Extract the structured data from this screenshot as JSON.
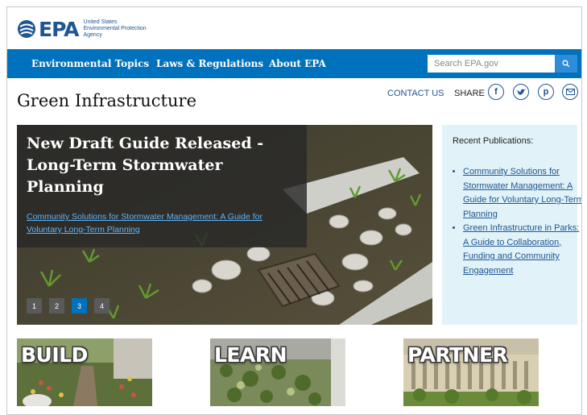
{
  "header": {
    "logo_text": "EPA",
    "agency_lines": [
      "United States",
      "Environmental Protection",
      "Agency"
    ]
  },
  "nav": {
    "items": [
      {
        "label": "Environmental Topics"
      },
      {
        "label": "Laws & Regulations"
      },
      {
        "label": "About EPA"
      }
    ],
    "search_placeholder": "Search EPA.gov"
  },
  "page": {
    "title": "Green Infrastructure",
    "contact_label": "CONTACT US",
    "share_label": "SHARE",
    "share_icons": [
      "facebook-icon",
      "twitter-icon",
      "pinterest-icon",
      "email-icon"
    ]
  },
  "carousel": {
    "title": "New Draft Guide Released - Long-Term Stormwater Planning",
    "link_text": "Community Solutions for Stormwater Management: A Guide for Voluntary Long-Term Planning",
    "pages": [
      "1",
      "2",
      "3",
      "4"
    ],
    "active_page": "3"
  },
  "sidebar": {
    "title": "Recent Publications:",
    "items": [
      {
        "label": "Community Solutions for Stormwater Management: A Guide for Voluntary Long-Term Planning"
      },
      {
        "label": "Green Infrastructure in Parks: A Guide to Collaboration, Funding and Community Engagement"
      }
    ]
  },
  "tiles": [
    {
      "label": "BUILD"
    },
    {
      "label": "LEARN"
    },
    {
      "label": "PARTNER"
    }
  ],
  "colors": {
    "brand_blue": "#205493",
    "nav_blue": "#0071bc",
    "sidebar_bg": "#e1f3f8",
    "link_blue": "#62b5f5"
  }
}
